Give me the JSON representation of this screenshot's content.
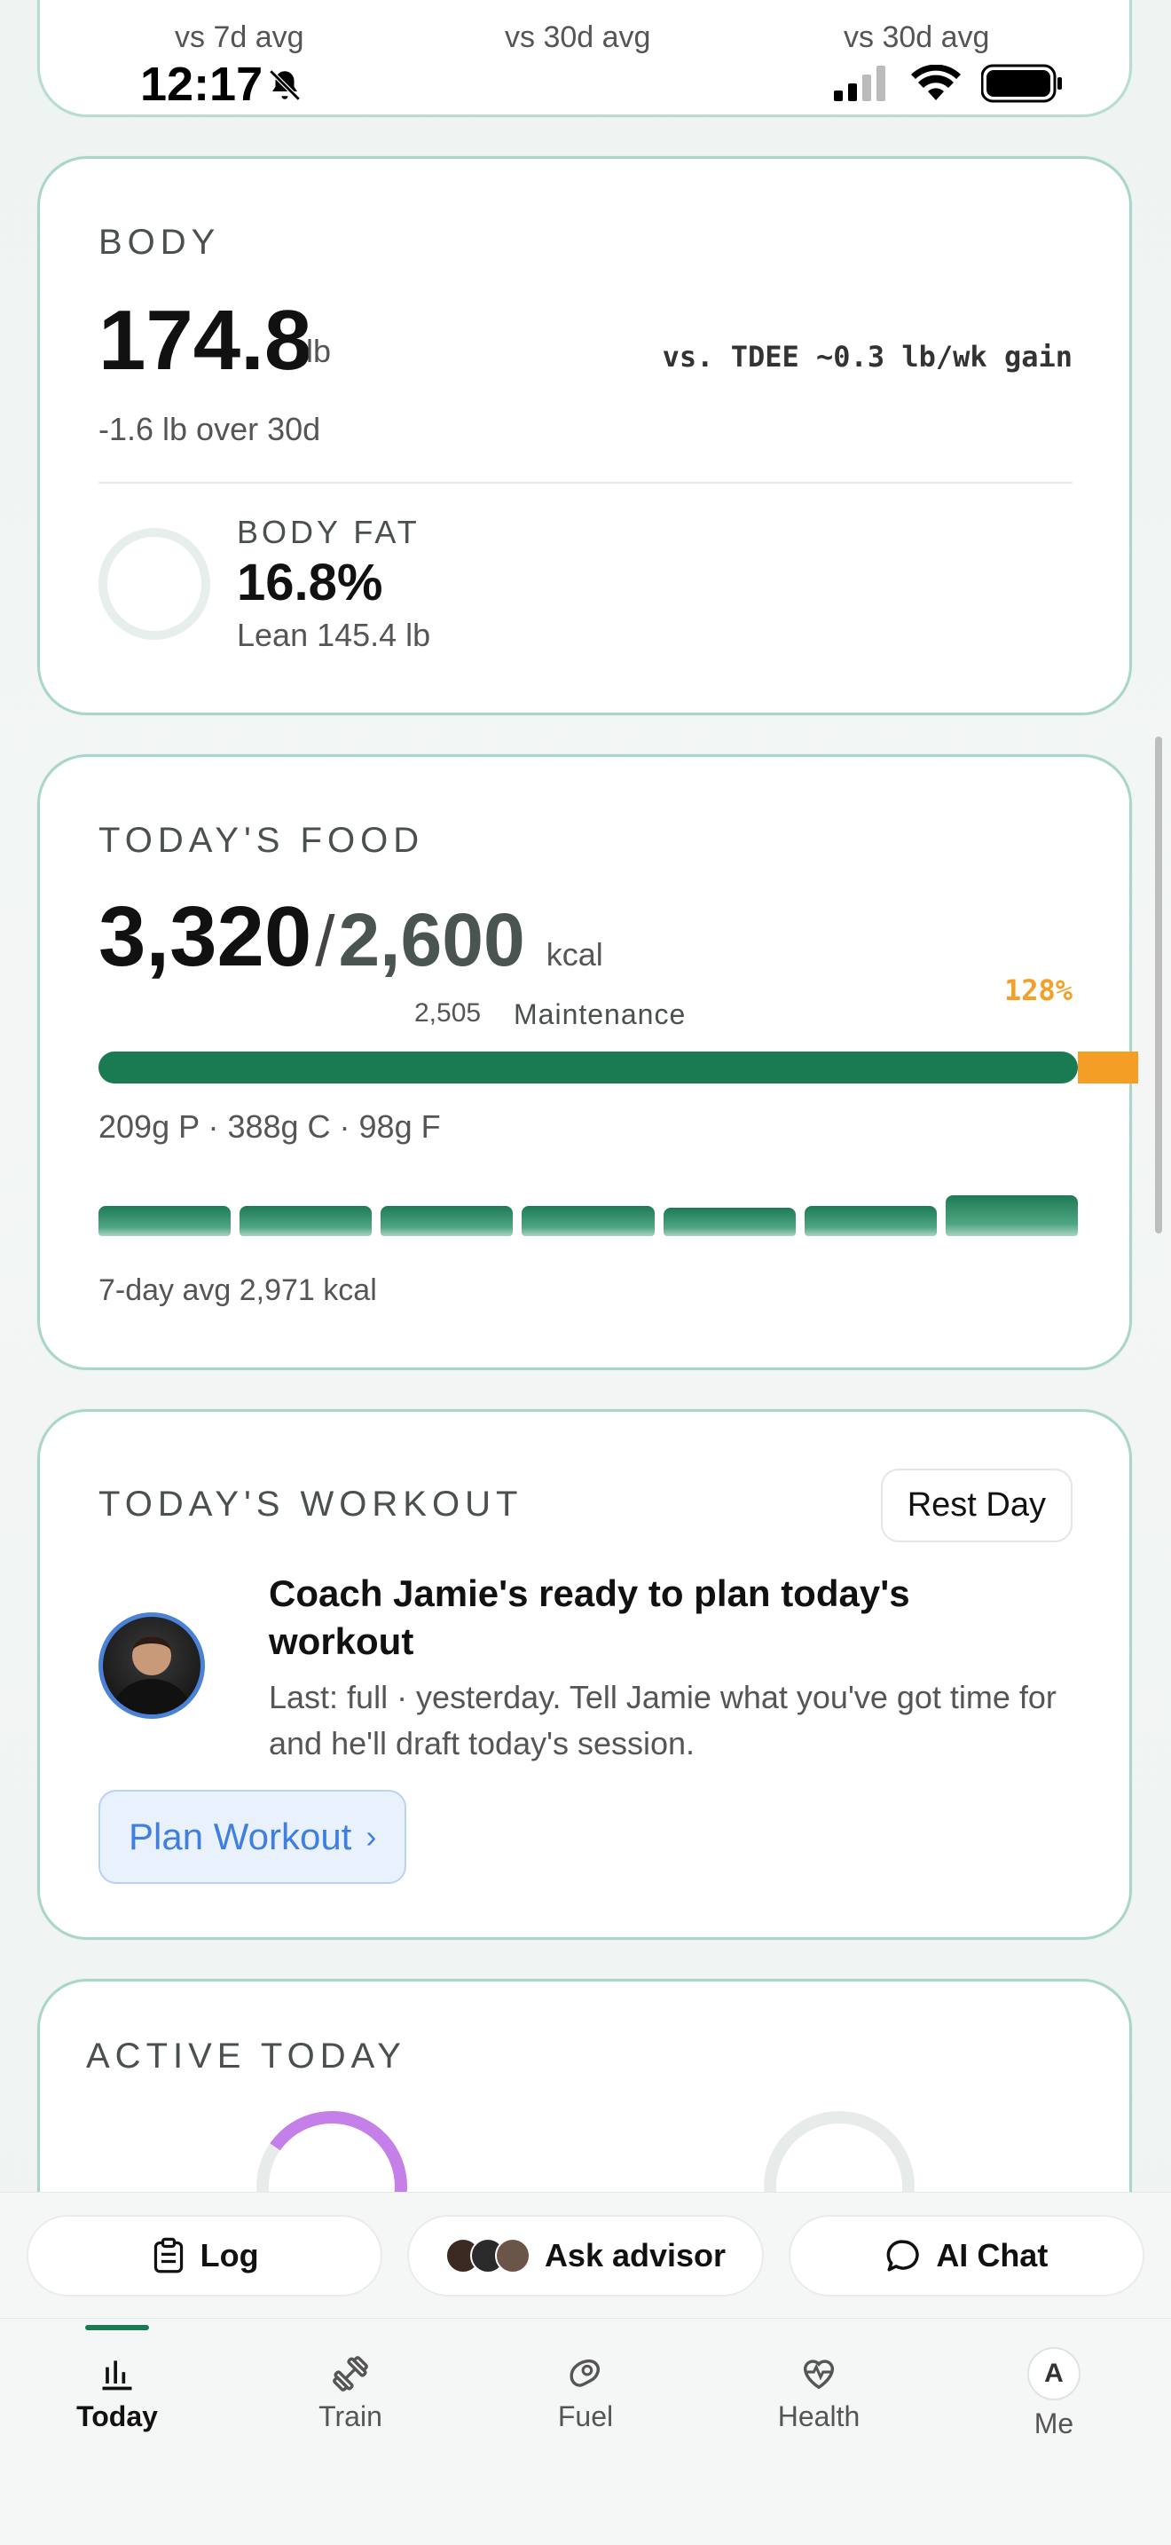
{
  "status_bar": {
    "time": "12:17"
  },
  "top_card": {
    "sub1": "vs 7d avg",
    "sub2": "vs 30d avg",
    "sub3": "vs 30d avg"
  },
  "body": {
    "title": "BODY",
    "weight": "174.8",
    "weight_unit": "lb",
    "tdee": "vs. TDEE ~0.3 lb/wk gain",
    "delta": "-1.6 lb over 30d",
    "bodyfat_label": "BODY FAT",
    "bodyfat_value": "16.8%",
    "lean": "Lean 145.4 lb"
  },
  "food": {
    "title": "TODAY'S FOOD",
    "consumed": "3,320",
    "slash": "/",
    "target": "2,600",
    "unit": "kcal",
    "maintenance_value": "2,505",
    "maintenance_label": "Maintenance",
    "percent": "128%",
    "macros": "209g P · 388g C · 98g F",
    "week_avg": "7-day avg 2,971 kcal",
    "week_levels": [
      0.52,
      0.52,
      0.52,
      0.52,
      0.48,
      0.52,
      0.7
    ]
  },
  "workout": {
    "title": "TODAY'S WORKOUT",
    "rest_day": "Rest Day",
    "coach_title": "Coach Jamie's ready to plan today's workout",
    "coach_desc": "Last: full · yesterday. Tell Jamie what you've got time for and he'll draft today's session.",
    "plan_button": "Plan Workout",
    "plan_chevron": "›"
  },
  "active": {
    "title": "ACTIVE TODAY"
  },
  "actions": {
    "log": "Log",
    "ask_advisor": "Ask advisor",
    "ai_chat": "AI Chat"
  },
  "tabs": {
    "today": "Today",
    "train": "Train",
    "fuel": "Fuel",
    "health": "Health",
    "me": "Me",
    "me_initial": "A"
  },
  "colors": {
    "accent_green": "#1a7a52",
    "over_orange": "#f59e26",
    "link_blue": "#3f7fe0",
    "ring_purple": "#c57fe8"
  }
}
